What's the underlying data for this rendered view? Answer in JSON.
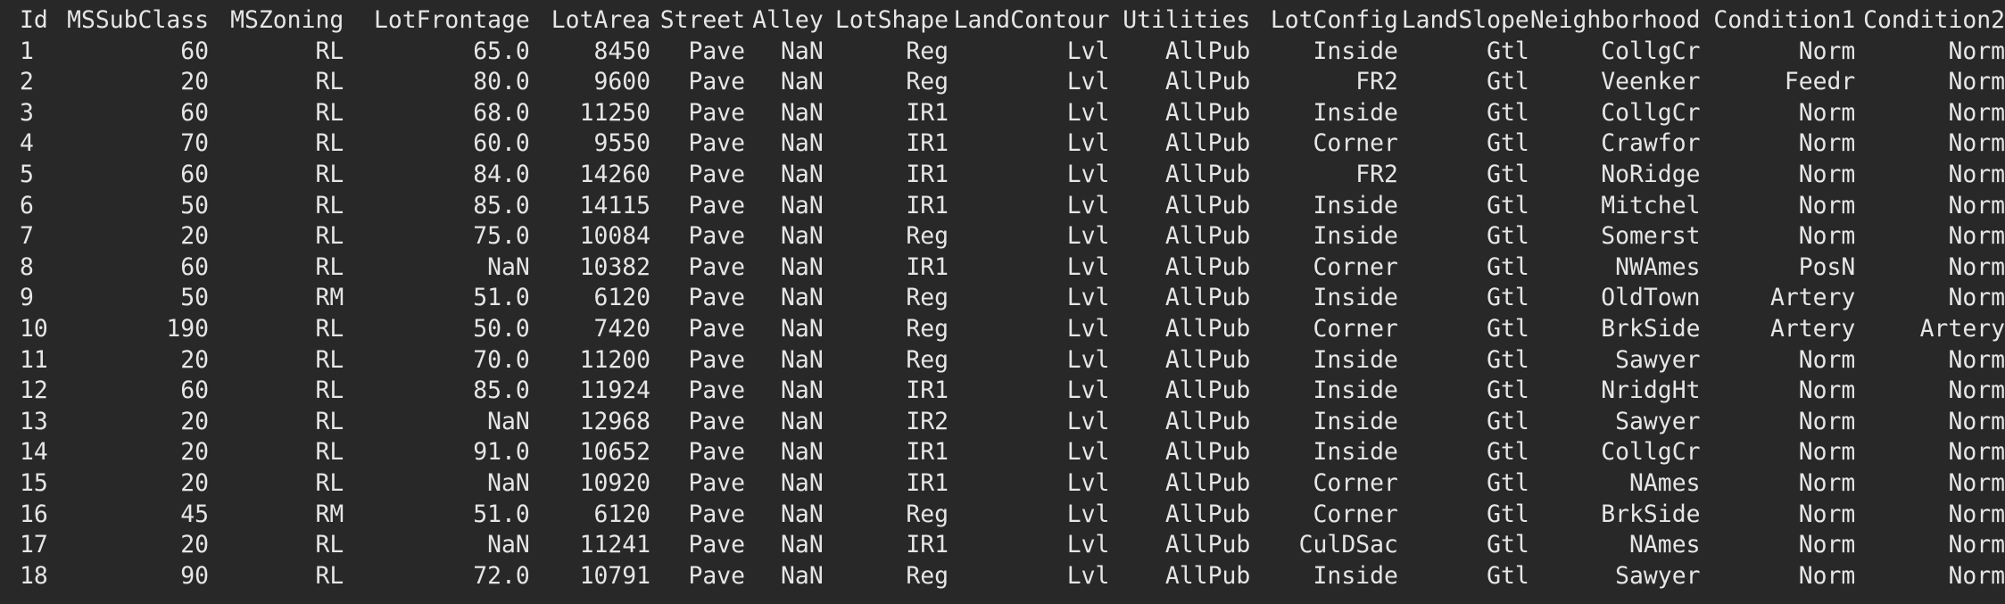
{
  "columns": [
    "Id",
    "MSSubClass",
    "MSZoning",
    "LotFrontage",
    "LotArea",
    "Street",
    "Alley",
    "LotShape",
    "LandContour",
    "Utilities",
    "LotConfig",
    "LandSlope",
    "Neighborhood",
    "Condition1",
    "Condition2"
  ],
  "rows": [
    [
      "1",
      "60",
      "RL",
      "65.0",
      "8450",
      "Pave",
      "NaN",
      "Reg",
      "Lvl",
      "AllPub",
      "Inside",
      "Gtl",
      "CollgCr",
      "Norm",
      "Norm"
    ],
    [
      "2",
      "20",
      "RL",
      "80.0",
      "9600",
      "Pave",
      "NaN",
      "Reg",
      "Lvl",
      "AllPub",
      "FR2",
      "Gtl",
      "Veenker",
      "Feedr",
      "Norm"
    ],
    [
      "3",
      "60",
      "RL",
      "68.0",
      "11250",
      "Pave",
      "NaN",
      "IR1",
      "Lvl",
      "AllPub",
      "Inside",
      "Gtl",
      "CollgCr",
      "Norm",
      "Norm"
    ],
    [
      "4",
      "70",
      "RL",
      "60.0",
      "9550",
      "Pave",
      "NaN",
      "IR1",
      "Lvl",
      "AllPub",
      "Corner",
      "Gtl",
      "Crawfor",
      "Norm",
      "Norm"
    ],
    [
      "5",
      "60",
      "RL",
      "84.0",
      "14260",
      "Pave",
      "NaN",
      "IR1",
      "Lvl",
      "AllPub",
      "FR2",
      "Gtl",
      "NoRidge",
      "Norm",
      "Norm"
    ],
    [
      "6",
      "50",
      "RL",
      "85.0",
      "14115",
      "Pave",
      "NaN",
      "IR1",
      "Lvl",
      "AllPub",
      "Inside",
      "Gtl",
      "Mitchel",
      "Norm",
      "Norm"
    ],
    [
      "7",
      "20",
      "RL",
      "75.0",
      "10084",
      "Pave",
      "NaN",
      "Reg",
      "Lvl",
      "AllPub",
      "Inside",
      "Gtl",
      "Somerst",
      "Norm",
      "Norm"
    ],
    [
      "8",
      "60",
      "RL",
      "NaN",
      "10382",
      "Pave",
      "NaN",
      "IR1",
      "Lvl",
      "AllPub",
      "Corner",
      "Gtl",
      "NWAmes",
      "PosN",
      "Norm"
    ],
    [
      "9",
      "50",
      "RM",
      "51.0",
      "6120",
      "Pave",
      "NaN",
      "Reg",
      "Lvl",
      "AllPub",
      "Inside",
      "Gtl",
      "OldTown",
      "Artery",
      "Norm"
    ],
    [
      "10",
      "190",
      "RL",
      "50.0",
      "7420",
      "Pave",
      "NaN",
      "Reg",
      "Lvl",
      "AllPub",
      "Corner",
      "Gtl",
      "BrkSide",
      "Artery",
      "Artery"
    ],
    [
      "11",
      "20",
      "RL",
      "70.0",
      "11200",
      "Pave",
      "NaN",
      "Reg",
      "Lvl",
      "AllPub",
      "Inside",
      "Gtl",
      "Sawyer",
      "Norm",
      "Norm"
    ],
    [
      "12",
      "60",
      "RL",
      "85.0",
      "11924",
      "Pave",
      "NaN",
      "IR1",
      "Lvl",
      "AllPub",
      "Inside",
      "Gtl",
      "NridgHt",
      "Norm",
      "Norm"
    ],
    [
      "13",
      "20",
      "RL",
      "NaN",
      "12968",
      "Pave",
      "NaN",
      "IR2",
      "Lvl",
      "AllPub",
      "Inside",
      "Gtl",
      "Sawyer",
      "Norm",
      "Norm"
    ],
    [
      "14",
      "20",
      "RL",
      "91.0",
      "10652",
      "Pave",
      "NaN",
      "IR1",
      "Lvl",
      "AllPub",
      "Inside",
      "Gtl",
      "CollgCr",
      "Norm",
      "Norm"
    ],
    [
      "15",
      "20",
      "RL",
      "NaN",
      "10920",
      "Pave",
      "NaN",
      "IR1",
      "Lvl",
      "AllPub",
      "Corner",
      "Gtl",
      "NAmes",
      "Norm",
      "Norm"
    ],
    [
      "16",
      "45",
      "RM",
      "51.0",
      "6120",
      "Pave",
      "NaN",
      "Reg",
      "Lvl",
      "AllPub",
      "Corner",
      "Gtl",
      "BrkSide",
      "Norm",
      "Norm"
    ],
    [
      "17",
      "20",
      "RL",
      "NaN",
      "11241",
      "Pave",
      "NaN",
      "IR1",
      "Lvl",
      "AllPub",
      "CulDSac",
      "Gtl",
      "NAmes",
      "Norm",
      "Norm"
    ],
    [
      "18",
      "90",
      "RL",
      "72.0",
      "10791",
      "Pave",
      "NaN",
      "Reg",
      "Lvl",
      "AllPub",
      "Inside",
      "Gtl",
      "Sawyer",
      "Norm",
      "Norm"
    ]
  ]
}
